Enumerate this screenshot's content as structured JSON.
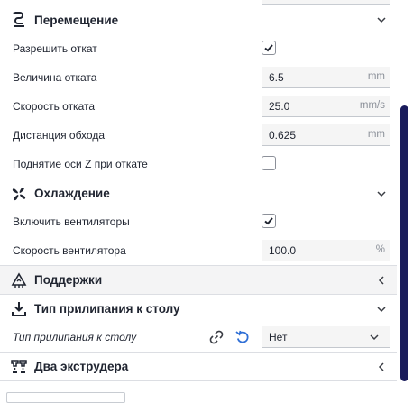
{
  "sections": {
    "travel": {
      "title": "Перемещение",
      "icon": "travel-icon"
    },
    "cooling": {
      "title": "Охлаждение",
      "icon": "fan-icon"
    },
    "support": {
      "title": "Поддержки",
      "icon": "support-icon"
    },
    "adhesion": {
      "title": "Тип прилипания к столу",
      "icon": "bed-adhesion-icon"
    },
    "dual": {
      "title": "Два экструдера",
      "icon": "dual-extruder-icon"
    }
  },
  "travel": {
    "retraction_enable": {
      "label": "Разрешить откат",
      "checked": true
    },
    "retraction_amount": {
      "label": "Величина отката",
      "value": "6.5",
      "unit": "mm"
    },
    "retraction_speed": {
      "label": "Скорость отката",
      "value": "25.0",
      "unit": "mm/s"
    },
    "avoid_distance": {
      "label": "Дистанция обхода",
      "value": "0.625",
      "unit": "mm"
    },
    "z_hop": {
      "label": "Поднятие оси Z при откате",
      "checked": false
    }
  },
  "cooling": {
    "fan_enable": {
      "label": "Включить вентиляторы",
      "checked": true
    },
    "fan_speed": {
      "label": "Скорость вентилятора",
      "value": "100.0",
      "unit": "%"
    }
  },
  "adhesion": {
    "type": {
      "label": "Тип прилипания к столу",
      "value": "Нет"
    }
  },
  "colors": {
    "accent": "#1a1c5c",
    "link_icon": "#3a3d44",
    "reset_icon": "#2f6fd6"
  }
}
